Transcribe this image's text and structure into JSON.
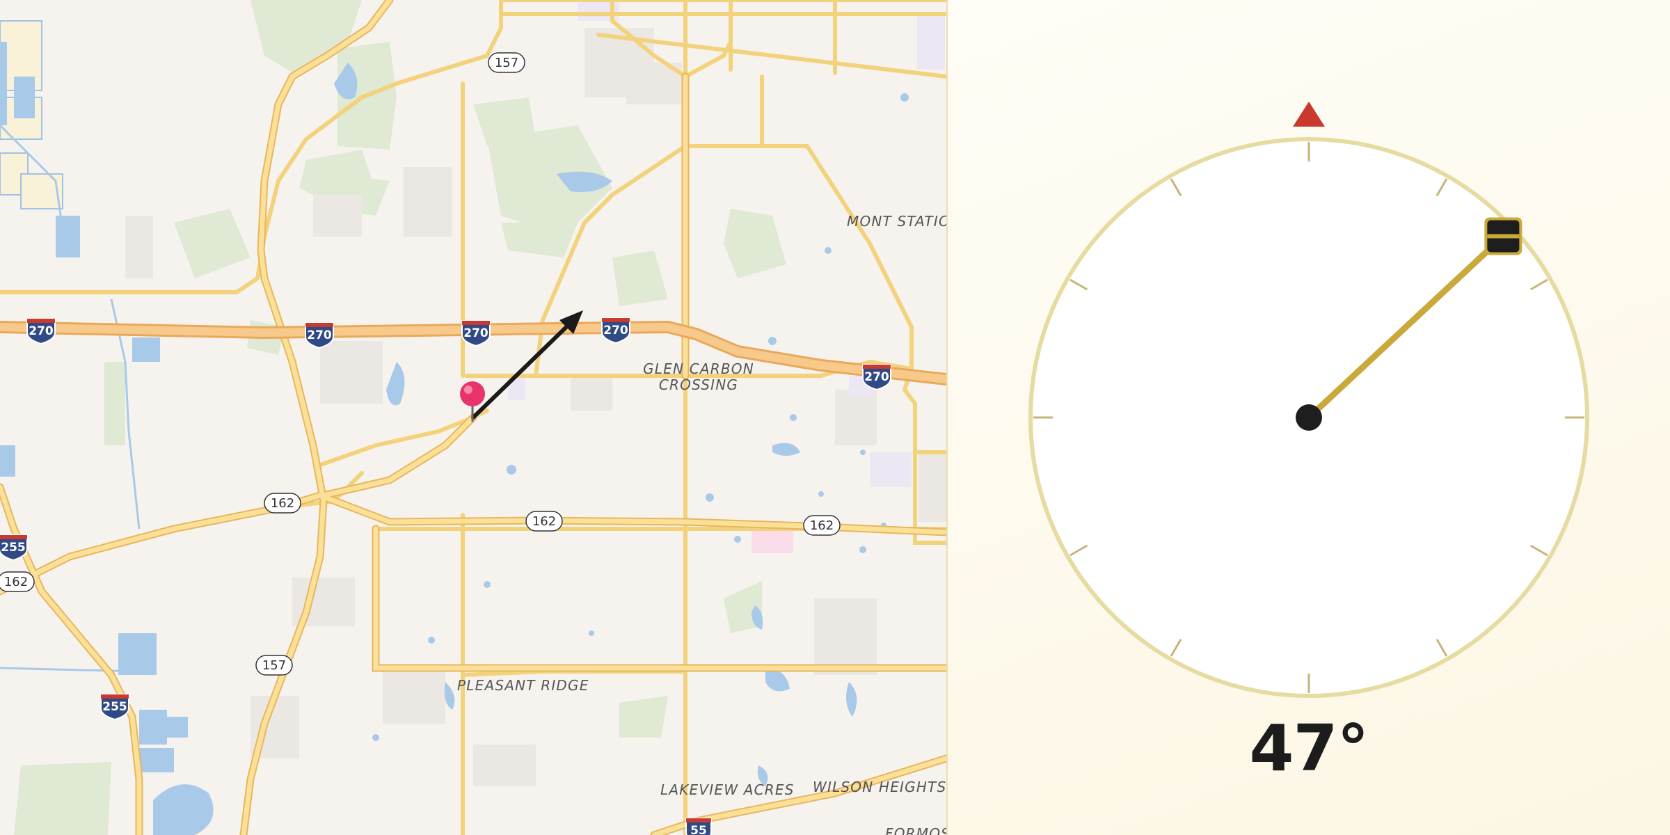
{
  "map": {
    "place_labels": [
      {
        "id": "mont-station",
        "text": "MONT STATIO"
      },
      {
        "id": "glen-carbon-1",
        "text": "GLEN CARBON"
      },
      {
        "id": "glen-carbon-2",
        "text": "CROSSING"
      },
      {
        "id": "pleasant-ridge",
        "text": "PLEASANT RIDGE"
      },
      {
        "id": "lakeview-acres",
        "text": "LAKEVIEW ACRES"
      },
      {
        "id": "wilson-heights",
        "text": "WILSON HEIGHTS"
      },
      {
        "id": "formosa",
        "text": "FORMOS"
      }
    ],
    "route_shields": [
      {
        "id": "s157a",
        "text": "157",
        "kind": "state"
      },
      {
        "id": "s157b",
        "text": "157",
        "kind": "state"
      },
      {
        "id": "s162a",
        "text": "162",
        "kind": "state"
      },
      {
        "id": "s162b",
        "text": "162",
        "kind": "state"
      },
      {
        "id": "s162c",
        "text": "162",
        "kind": "state"
      },
      {
        "id": "s162d",
        "text": "162",
        "kind": "state"
      },
      {
        "id": "i270a",
        "text": "270",
        "kind": "interstate"
      },
      {
        "id": "i270b",
        "text": "270",
        "kind": "interstate"
      },
      {
        "id": "i270c",
        "text": "270",
        "kind": "interstate"
      },
      {
        "id": "i270d",
        "text": "270",
        "kind": "interstate"
      },
      {
        "id": "i270e",
        "text": "270",
        "kind": "interstate"
      },
      {
        "id": "i255a",
        "text": "255",
        "kind": "interstate"
      },
      {
        "id": "i255b",
        "text": "255",
        "kind": "interstate"
      },
      {
        "id": "i55a",
        "text": "55",
        "kind": "interstate"
      }
    ],
    "marker": {
      "icon": "map-pin-icon",
      "color": "#e8336b"
    },
    "direction_arrow": {
      "icon": "heading-arrow-icon",
      "heading_deg": 47
    }
  },
  "compass": {
    "heading_deg": 47,
    "heading_text": "47°",
    "north_marker_color": "#c9392f",
    "needle_color": "#c9a93a",
    "dial_ring_color": "#e6dba0"
  }
}
